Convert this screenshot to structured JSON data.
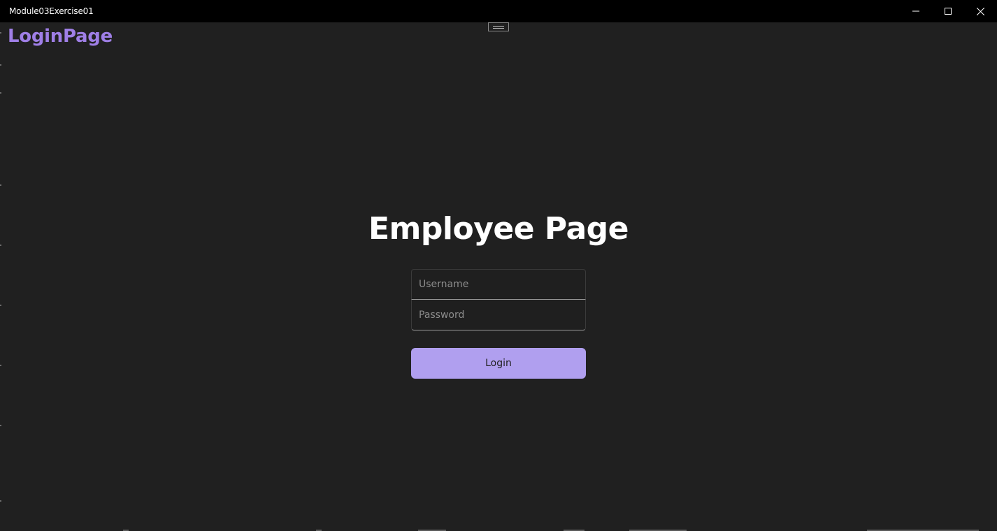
{
  "window": {
    "title": "Module03Exercise01",
    "controls": {
      "minimize_icon": "minimize-icon",
      "maximize_icon": "maximize-icon",
      "close_icon": "close-icon"
    }
  },
  "header": {
    "title": "LoginPage"
  },
  "main": {
    "title": "Employee Page",
    "username": {
      "value": "",
      "placeholder": "Username"
    },
    "password": {
      "value": "",
      "placeholder": "Password"
    },
    "login_label": "Login"
  },
  "colors": {
    "titlebar_bg": "#000000",
    "app_bg": "#202020",
    "header_accent": "#9f7fe6",
    "button_bg": "#b09fef",
    "button_text": "#1f1f1f",
    "text_primary": "#ffffff",
    "placeholder": "#8d8d8d"
  }
}
